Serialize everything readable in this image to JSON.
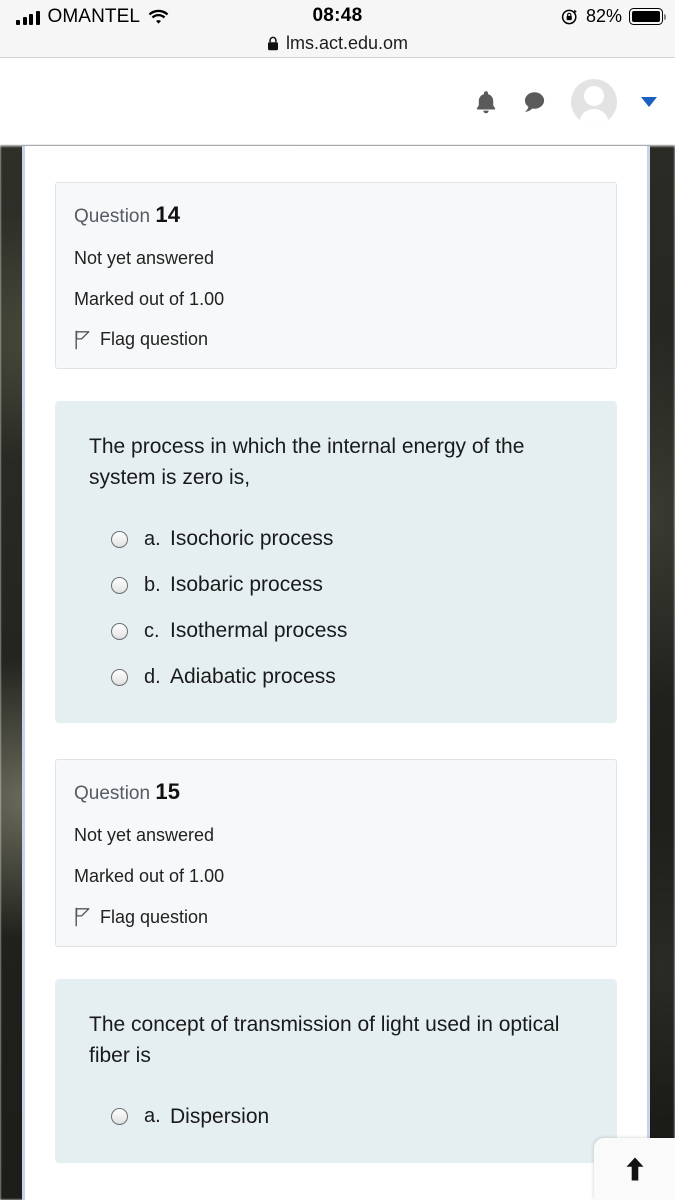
{
  "status_bar": {
    "carrier": "OMANTEL",
    "signal_icon": "cellular-signal-icon",
    "wifi_icon": "wifi-icon",
    "time": "08:48",
    "rotation_lock_icon": "rotation-lock-icon",
    "battery_percent": "82%",
    "battery_icon": "battery-icon"
  },
  "browser": {
    "lock_icon": "lock-icon",
    "url": "lms.act.edu.om"
  },
  "navbar": {
    "notifications_icon": "bell-icon",
    "messages_icon": "chat-bubble-icon",
    "avatar_icon": "user-avatar",
    "dropdown_icon": "caret-down-icon",
    "caret_color": "#1b5fc1"
  },
  "theme": {
    "info_box_bg": "#f7f8f9",
    "info_box_border": "#dfe3e6",
    "content_bg": "#e5eff2",
    "page_border": "#c9d3ee"
  },
  "questions": [
    {
      "info": {
        "label": "Question",
        "number": "14",
        "state": "Not yet answered",
        "marks": "Marked out of 1.00",
        "flag_label": "Flag question",
        "flag_icon": "flag-icon"
      },
      "content": {
        "text": "The process in which the internal energy of the system is zero is,",
        "options": [
          {
            "letter": "a.",
            "label": "Isochoric process",
            "selected": false
          },
          {
            "letter": "b.",
            "label": "Isobaric process",
            "selected": false
          },
          {
            "letter": "c.",
            "label": "Isothermal process",
            "selected": false
          },
          {
            "letter": "d.",
            "label": "Adiabatic process",
            "selected": false
          }
        ]
      }
    },
    {
      "info": {
        "label": "Question",
        "number": "15",
        "state": "Not yet answered",
        "marks": "Marked out of 1.00",
        "flag_label": "Flag question",
        "flag_icon": "flag-icon"
      },
      "content": {
        "text": "The concept of transmission of light used in optical fiber is",
        "options": [
          {
            "letter": "a.",
            "label": "Dispersion",
            "selected": false
          }
        ]
      }
    }
  ],
  "floating": {
    "back_to_top_icon": "arrow-up-icon"
  }
}
